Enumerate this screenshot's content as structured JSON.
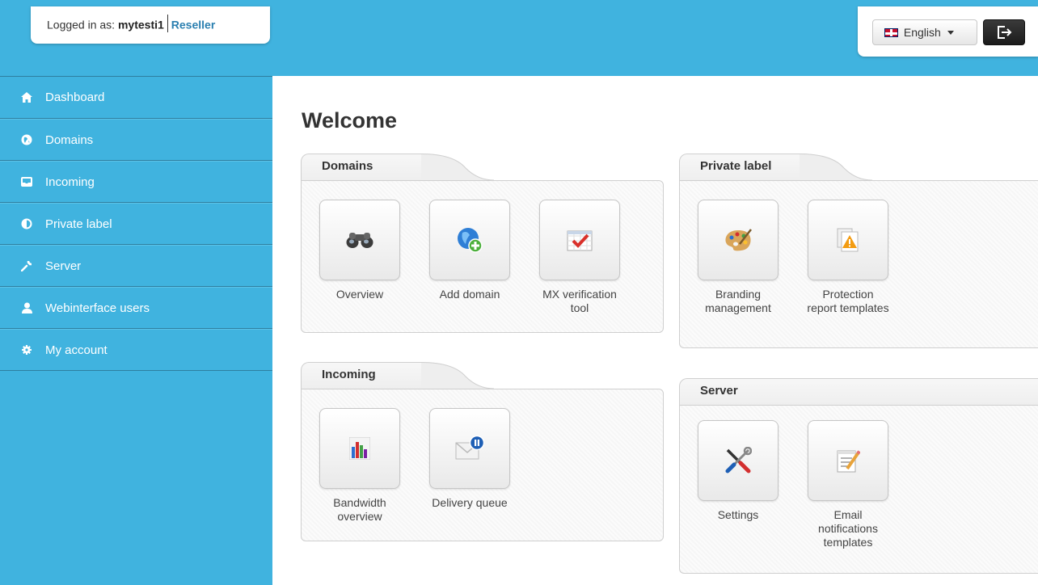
{
  "header": {
    "logged_in_prefix": "Logged in as:",
    "username": "mytesti1",
    "role": "Reseller",
    "language": "English"
  },
  "sidebar": {
    "items": [
      {
        "label": "Dashboard",
        "icon": "home-icon"
      },
      {
        "label": "Domains",
        "icon": "globe-icon"
      },
      {
        "label": "Incoming",
        "icon": "inbox-icon"
      },
      {
        "label": "Private label",
        "icon": "contrast-icon"
      },
      {
        "label": "Server",
        "icon": "wrench-icon"
      },
      {
        "label": "Webinterface users",
        "icon": "user-icon"
      },
      {
        "label": "My account",
        "icon": "cog-icon"
      }
    ]
  },
  "main": {
    "title": "Welcome",
    "panels": {
      "domains": {
        "title": "Domains",
        "tiles": [
          {
            "label": "Overview",
            "icon": "binoculars-icon"
          },
          {
            "label": "Add domain",
            "icon": "add-globe-icon"
          },
          {
            "label": "MX verification tool",
            "icon": "checklist-icon"
          }
        ]
      },
      "private_label": {
        "title": "Private label",
        "tiles": [
          {
            "label": "Branding management",
            "icon": "palette-icon"
          },
          {
            "label": "Protection report templates",
            "icon": "warning-document-icon"
          }
        ]
      },
      "incoming": {
        "title": "Incoming",
        "tiles": [
          {
            "label": "Bandwidth overview",
            "icon": "bar-chart-icon"
          },
          {
            "label": "Delivery queue",
            "icon": "mail-pause-icon"
          }
        ]
      },
      "server": {
        "title": "Server",
        "tiles": [
          {
            "label": "Settings",
            "icon": "tools-icon"
          },
          {
            "label": "Email notifications templates",
            "icon": "notepad-icon"
          }
        ]
      }
    }
  },
  "colors": {
    "accent": "#40b3df",
    "role_link": "#2a7fb0",
    "logout_bg": "#1b1b1b"
  }
}
